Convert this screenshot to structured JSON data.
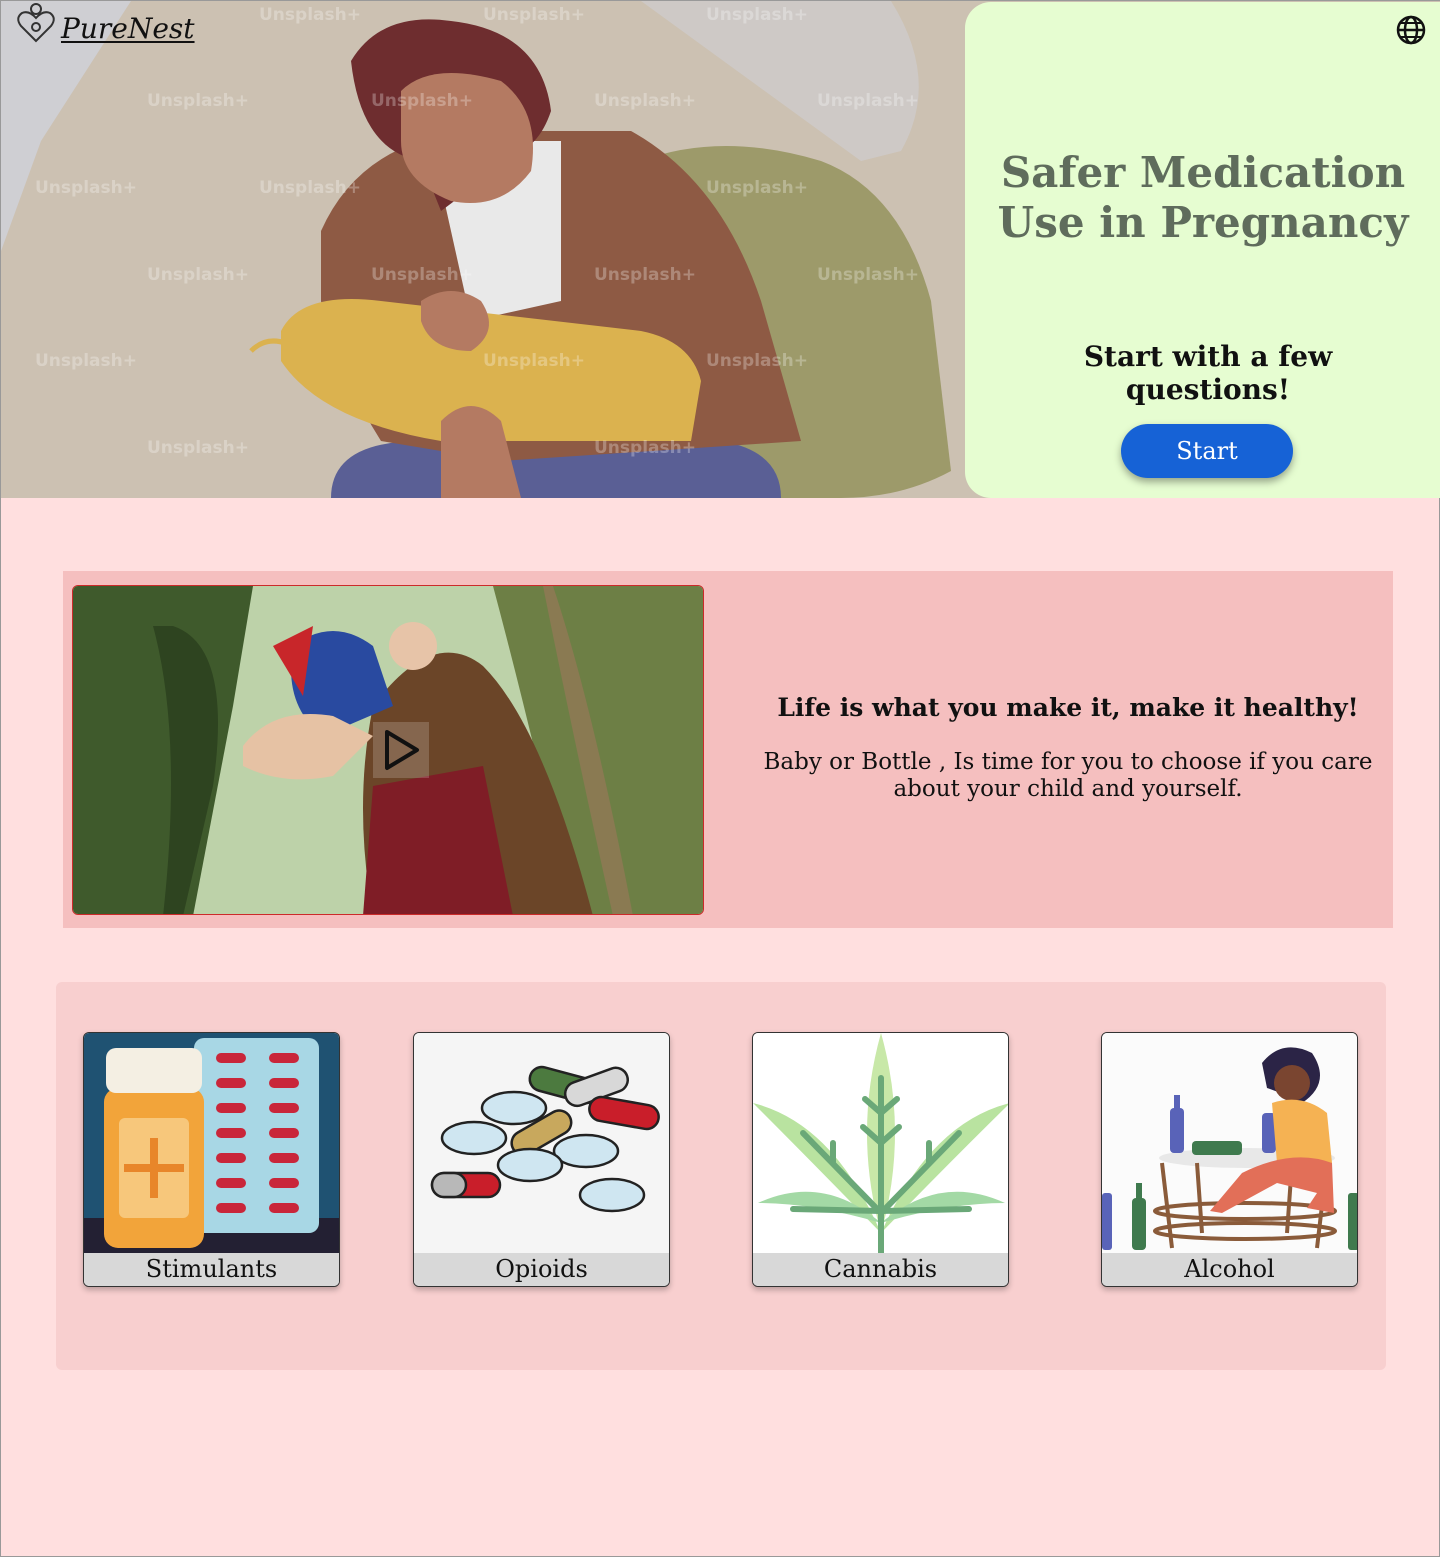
{
  "brand": {
    "name": "PureNest"
  },
  "hero": {
    "title": "Safer Medication Use in Pregnancy",
    "subtitle": "Start with a few questions!",
    "start_label": "Start",
    "watermark_text": "Unsplash+",
    "language_icon": "globe-icon",
    "start_color": "#1662d6",
    "panel_color": "#e6fdd1"
  },
  "video": {
    "heading": "Life is what you make it, make it healthy!",
    "body": "Baby or Bottle , Is time for you to choose if you care about your child and yourself.",
    "play_icon": "play-icon"
  },
  "categories": [
    {
      "label": "Stimulants"
    },
    {
      "label": "Opioids"
    },
    {
      "label": "Cannabis"
    },
    {
      "label": "Alcohol"
    }
  ],
  "colors": {
    "page_background": "#ffdfdf",
    "video_section": "#f5bfbf",
    "categories_section": "#f8cfcf",
    "title_color": "#5f6c5c"
  }
}
